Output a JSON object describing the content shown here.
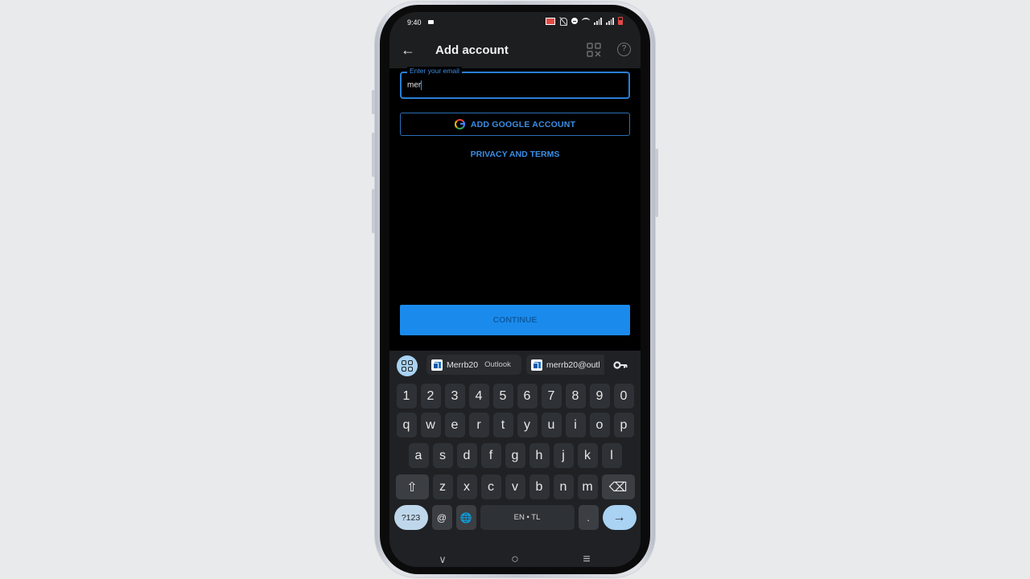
{
  "status_bar": {
    "time": "9:40",
    "icons": [
      "screen-record-icon",
      "cast-icon",
      "mute-icon",
      "do-not-disturb-icon",
      "wifi-icon",
      "signal-icon",
      "signal-icon",
      "battery-low-icon"
    ]
  },
  "app_bar": {
    "title": "Add account",
    "back_icon": "←",
    "help_icon": "?"
  },
  "form": {
    "email_label": "Enter your email",
    "email_value": "mer",
    "google_button_label": "ADD GOOGLE ACCOUNT",
    "privacy_link": "PRIVACY AND TERMS",
    "continue_label": "CONTINUE"
  },
  "colors": {
    "accent": "#3a8ee6",
    "continue_bg": "#1a8bec",
    "continue_text": "#0e5ea8",
    "app_bar_bg": "#1d1e20",
    "keyboard_bg": "#1f2124"
  },
  "keyboard": {
    "suggestions": [
      {
        "text": "Merrb20",
        "sub": "Outlook"
      },
      {
        "text": "merrb20@outl",
        "sub": ""
      }
    ],
    "row_numbers": [
      "1",
      "2",
      "3",
      "4",
      "5",
      "6",
      "7",
      "8",
      "9",
      "0"
    ],
    "row_1": [
      "q",
      "w",
      "e",
      "r",
      "t",
      "y",
      "u",
      "i",
      "o",
      "p"
    ],
    "row_2": [
      "a",
      "s",
      "d",
      "f",
      "g",
      "h",
      "j",
      "k",
      "l"
    ],
    "row_3": [
      "z",
      "x",
      "c",
      "v",
      "b",
      "n",
      "m"
    ],
    "shift_icon": "⇧",
    "backspace_icon": "⌫",
    "symbols_label": "?123",
    "at_label": "@",
    "globe_icon": "🌐",
    "space_label": "EN • TL",
    "period_label": ".",
    "enter_icon": "→"
  },
  "nav_bar": {
    "hide_keyboard_icon": "∨",
    "home_icon": "○",
    "recents_icon": "≡"
  }
}
